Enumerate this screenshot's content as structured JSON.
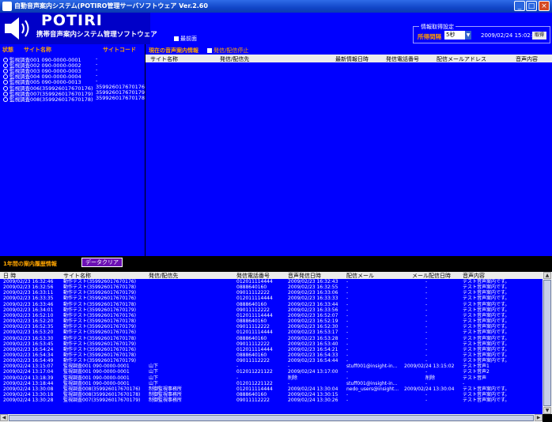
{
  "window": {
    "title": "自動音声案内システム(POTIRO管理サーバソフトウェア Ver.2.60"
  },
  "logo": {
    "title": "POTIRI",
    "subtitle": "携帯音声案内システム管理ソフトウェア"
  },
  "header": {
    "prev_screen": "最前面",
    "settings_legend": "情報取得設定",
    "interval_label": "所得間隔",
    "interval_value": "5秒",
    "timestamp": "2009/02/24 15:02:01",
    "retrieve_button": "取得"
  },
  "left_panel": {
    "col_status": "状態",
    "col_site": "サイト名称",
    "col_code": "サイトコード",
    "rows": [
      {
        "name": "監視調査001 090-0000-0001",
        "code": "-"
      },
      {
        "name": "監視調査002 090-0000-0002",
        "code": "-"
      },
      {
        "name": "監視調査003 090-0000-0003",
        "code": "-"
      },
      {
        "name": "監視調査004 090-0000-0004",
        "code": "-"
      },
      {
        "name": "監視調査005 090-0000-0013",
        "code": "-"
      },
      {
        "name": "監視調査006(359926017670176)",
        "code": "359926017670176"
      },
      {
        "name": "監視調査007(359926017670179)",
        "code": "359926017670179"
      },
      {
        "name": "監視調査008(359926017670178)",
        "code": "359926017670178"
      }
    ]
  },
  "right_panel": {
    "title": "現在の音声案内情報",
    "stop_checkbox": "発信/配信停止",
    "columns": [
      "サイト名称",
      "発信/配信先",
      "最新情報日時",
      "発信電話番号",
      "配信メールアドレス",
      "音声内容"
    ]
  },
  "history": {
    "title": "1年間の案内履歴情報",
    "clear_button": "データクリア",
    "columns": [
      "日 時",
      "サイト名称",
      "発信/配信先",
      "発信電話番号",
      "音声発信日時",
      "配信メール",
      "メール配信日時",
      "音声内容"
    ],
    "rows": [
      [
        "2009/02/23 16:32:46",
        "動作テスト(359926017670176)",
        "",
        "012011114444",
        "2009/02/23 16:32:43",
        "-",
        "-",
        "テスト音声案内です。"
      ],
      [
        "2009/02/23 16:32:56",
        "動作テスト(359926017670178)",
        "",
        "0888640160",
        "2009/02/23 16:32:55",
        "-",
        "-",
        "テスト音声案内です。"
      ],
      [
        "2009/02/23 16:33:11",
        "動作テスト(359926017670179)",
        "",
        "09011112222",
        "2009/02/23 16:33:06",
        "-",
        "-",
        "テスト音声案内です。"
      ],
      [
        "2009/02/23 16:33:35",
        "動作テスト(359926017670176)",
        "",
        "012011114444",
        "2009/02/23 16:33:33",
        "-",
        "-",
        "テスト音声案内です。"
      ],
      [
        "2009/02/23 16:33:46",
        "動作テスト(359926017670178)",
        "",
        "0888640160",
        "2009/02/23 16:33:44",
        "-",
        "-",
        "テスト音声案内です。"
      ],
      [
        "2009/02/23 16:34:01",
        "動作テスト(359926017670179)",
        "",
        "09011112222",
        "2009/02/23 16:33:56",
        "-",
        "-",
        "テスト音声案内です。"
      ],
      [
        "2009/02/23 16:52:10",
        "動作テスト(359926017670176)",
        "",
        "012011114444",
        "2009/02/23 16:52:07",
        "-",
        "-",
        "テスト音声案内です。"
      ],
      [
        "2009/02/23 16:52:20",
        "動作テスト(359926017670178)",
        "",
        "0888640160",
        "2009/02/23 16:52:19",
        "-",
        "-",
        "テスト音声案内です。"
      ],
      [
        "2009/02/23 16:52:35",
        "動作テスト(359926017670179)",
        "",
        "09011112222",
        "2009/02/23 16:52:30",
        "-",
        "-",
        "テスト音声案内です。"
      ],
      [
        "2009/02/23 16:53:20",
        "動作テスト(359926017670176)",
        "",
        "012011114444",
        "2009/02/23 16:53:17",
        "-",
        "-",
        "テスト音声案内です。"
      ],
      [
        "2009/02/23 16:53:30",
        "動作テスト(359926017670178)",
        "",
        "0888640160",
        "2009/02/23 16:53:28",
        "-",
        "-",
        "テスト音声案内です。"
      ],
      [
        "2009/02/23 16:53:45",
        "動作テスト(359926017670179)",
        "",
        "09011112222",
        "2009/02/23 16:53:40",
        "-",
        "-",
        "テスト音声案内です。"
      ],
      [
        "2009/02/23 16:54:24",
        "動作テスト(359926017670176)",
        "",
        "012011114444",
        "2009/02/23 16:54:21",
        "-",
        "-",
        "テスト音声案内です。"
      ],
      [
        "2009/02/23 16:54:34",
        "動作テスト(359926017670178)",
        "",
        "0888640160",
        "2009/02/23 16:54:33",
        "-",
        "-",
        "テスト音声案内です。"
      ],
      [
        "2009/02/23 16:54:49",
        "動作テスト(359926017670179)",
        "",
        "09011112222",
        "2009/02/23 16:54:44",
        "-",
        "-",
        "テスト音声案内です。"
      ],
      [
        "2009/02/24 13:15:07",
        "監視調査001 090-0000-0001",
        "山下",
        "-",
        "-",
        "stuff001@insight-in...",
        "2009/02/24 13:15:02",
        "テスト音声1"
      ],
      [
        "2009/02/24 13:17:04",
        "監視調査001 090-0000-0001",
        "山下",
        "012011221122",
        "2009/02/24 13:17:00",
        "-",
        "-",
        "テスト音声2"
      ],
      [
        "2009/02/24 13:18:39",
        "監視調査001 090-0000-0001",
        "山下",
        "-",
        "削除",
        "-",
        "削除",
        "テスト音声"
      ],
      [
        "2009/02/24 13:18:44",
        "監視調査001 090-0000-0001",
        "山下",
        "012011221122",
        "-",
        "stuff001@insight-in...",
        "-",
        "-"
      ],
      [
        "2009/02/24 13:30:08",
        "監視調査008(359926017670176)",
        "制御監視事務所",
        "012011114444",
        "2009/02/24 13:30:04",
        "nedo_users@insight...",
        "2009/02/24 13:30:04",
        "テスト音声案内です。"
      ],
      [
        "2009/02/24 13:30:18",
        "監視調査008(359926017670178)",
        "制御監視事務所",
        "0888640160",
        "2009/02/24 13:30:15",
        "-",
        "-",
        "テスト音声案内です。"
      ],
      [
        "2009/02/24 13:30:28",
        "監視調査007(359926017670179)",
        "制御監視事務所",
        "09011112222",
        "2009/02/24 13:30:26",
        "-",
        "-",
        "テスト音声案内です。"
      ]
    ]
  }
}
